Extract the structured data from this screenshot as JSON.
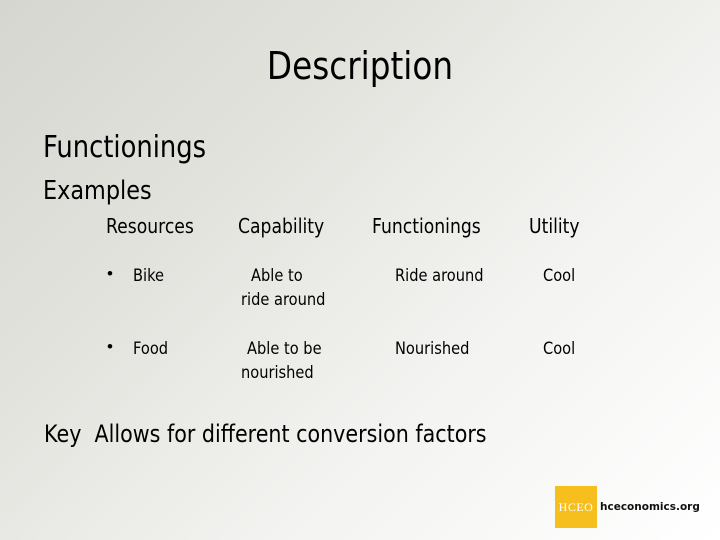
{
  "slide": {
    "title": "Description",
    "heading": "Functionings",
    "subheading": "Examples"
  },
  "table": {
    "headers": [
      "Resources",
      "Capability",
      "Functionings",
      "Utility"
    ],
    "rows": [
      {
        "bullet": "•",
        "resource": "Bike",
        "capability_line1": "Able to",
        "capability_line2": "ride around",
        "functioning": "Ride around",
        "utility": "Cool"
      },
      {
        "bullet": "•",
        "resource": "Food",
        "capability_line1": "Able to be",
        "capability_line2": "nourished",
        "functioning": "Nourished",
        "utility": "Cool"
      }
    ]
  },
  "key": {
    "label": "Key",
    "text": "Allows for different conversion factors"
  },
  "logo": {
    "mark": "HCEO",
    "site": "hceconomics.org",
    "color": "#f7bf1e"
  }
}
